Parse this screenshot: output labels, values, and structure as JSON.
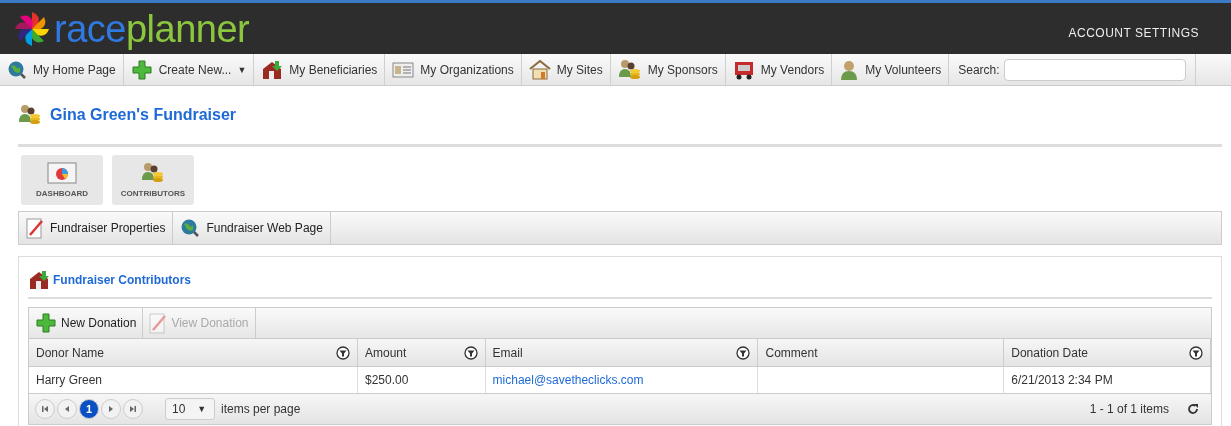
{
  "brand": {
    "part_1": "race",
    "part_2": "planner"
  },
  "account_link": "ACCOUNT SETTINGS",
  "nav": [
    {
      "label": "My Home Page",
      "kind": "globe"
    },
    {
      "label": "Create New...",
      "kind": "plus",
      "caret": "▼"
    },
    {
      "label": "My Beneficiaries",
      "kind": "house"
    },
    {
      "label": "My Organizations",
      "kind": "card"
    },
    {
      "label": "My Sites",
      "kind": "home"
    },
    {
      "label": "My Sponsors",
      "kind": "people"
    },
    {
      "label": "My Vendors",
      "kind": "truck"
    },
    {
      "label": "My Volunteers",
      "kind": "person"
    }
  ],
  "search": {
    "label": "Search:"
  },
  "page_title": "Gina Green's Fundraiser",
  "tiles": [
    {
      "label": "DASHBOARD",
      "kind": "chart"
    },
    {
      "label": "CONTRIBUTORS",
      "kind": "people"
    }
  ],
  "actions": [
    {
      "label": "Fundraiser Properties",
      "kind": "pencil"
    },
    {
      "label": "Fundraiser Web Page",
      "kind": "globe"
    }
  ],
  "panel": {
    "title": "Fundraiser Contributors",
    "toolbar": [
      {
        "label": "New Donation",
        "kind": "plus",
        "disabled": false
      },
      {
        "label": "View Donation",
        "kind": "pencil",
        "disabled": true
      }
    ],
    "table": {
      "columns": [
        {
          "label": "Donor Name",
          "filter": true
        },
        {
          "label": "Amount",
          "filter": true
        },
        {
          "label": "Email",
          "filter": true
        },
        {
          "label": "Comment",
          "filter": false
        },
        {
          "label": "Donation Date",
          "filter": true
        }
      ],
      "rows": [
        {
          "donor": "Harry Green",
          "amount": "$250.00",
          "email": "michael@savetheclicks.com",
          "date": "6/21/2013 2:34 PM"
        }
      ]
    },
    "pager": {
      "pages": [
        {
          "label": "1",
          "selected": true
        }
      ],
      "page_size": "10",
      "page_size_caret": "▼",
      "per_page_label": "items per page",
      "summary": "1 - 1 of 1 items"
    }
  }
}
